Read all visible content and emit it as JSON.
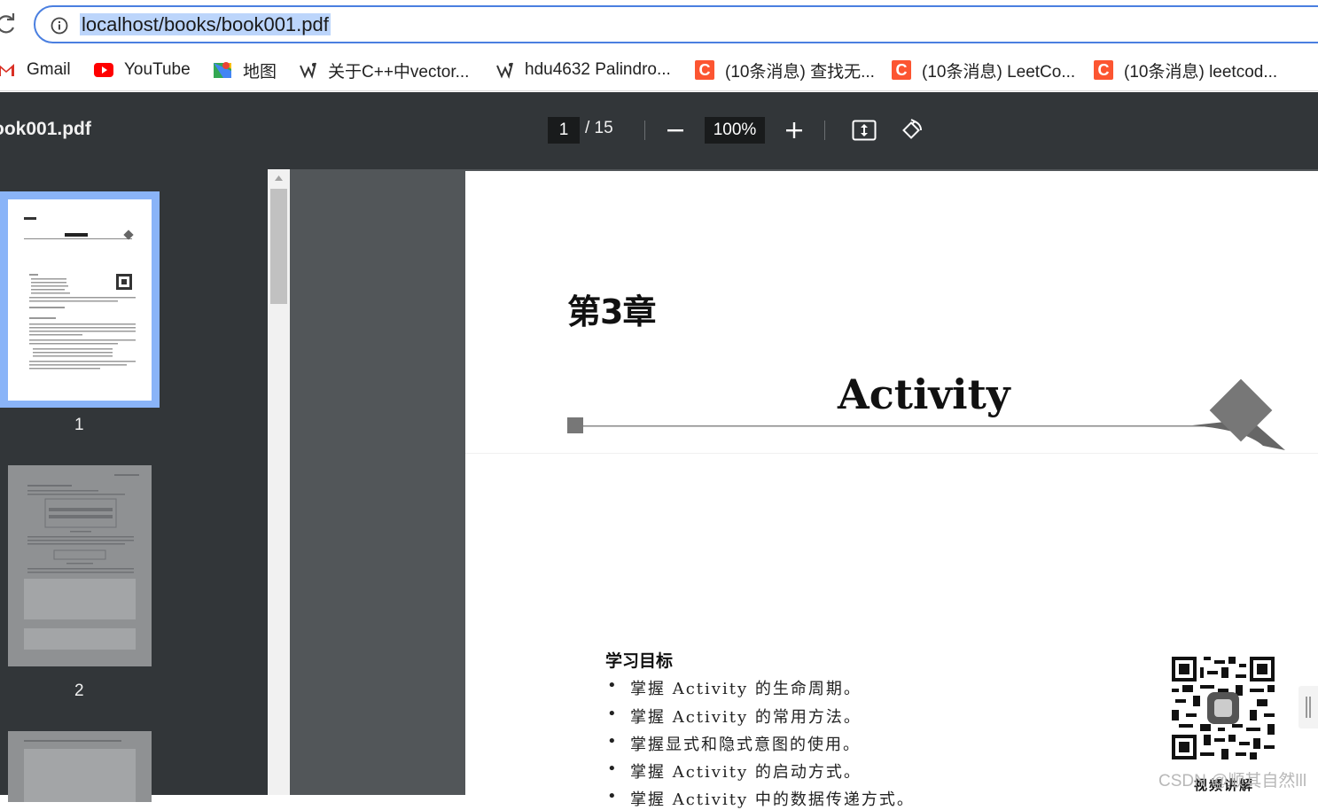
{
  "browser": {
    "url": "localhost/books/book001.pdf",
    "bookmarks": [
      {
        "label": "Gmail",
        "icon": "gmail-icon"
      },
      {
        "label": "YouTube",
        "icon": "youtube-icon"
      },
      {
        "label": "地图",
        "icon": "maps-icon"
      },
      {
        "label": "关于C++中vector...",
        "icon": "bookmark-site-icon"
      },
      {
        "label": "hdu4632 Palindro...",
        "icon": "bookmark-site-icon"
      },
      {
        "label": "(10条消息) 查找无...",
        "icon": "csdn-icon"
      },
      {
        "label": "(10条消息) LeetCo...",
        "icon": "csdn-icon"
      },
      {
        "label": "(10条消息) leetcod...",
        "icon": "csdn-icon"
      }
    ]
  },
  "pdf_toolbar": {
    "title": "ook001.pdf",
    "current_page": "1",
    "total_pages": "/ 15",
    "zoom": "100%"
  },
  "sidebar": {
    "thumbnails": [
      {
        "label": "1"
      },
      {
        "label": "2"
      }
    ]
  },
  "page": {
    "chapter": "第3章",
    "title": "Activity",
    "goals_heading": "学习目标",
    "goals": [
      "掌握 Activity 的生命周期。",
      "掌握 Activity 的常用方法。",
      "掌握显式和隐式意图的使用。",
      "掌握 Activity 的启动方式。",
      "掌握 Activity 中的数据传递方式。"
    ],
    "qr_label": "视频讲解"
  },
  "watermark": "CSDN @顺其自然lll",
  "colors": {
    "toolbar_bg": "#323639",
    "viewer_bg": "#525659",
    "selected_thumb": "#8ab4f8",
    "omnibox_border": "#4a7fe0",
    "csdn_red": "#fc5531"
  }
}
